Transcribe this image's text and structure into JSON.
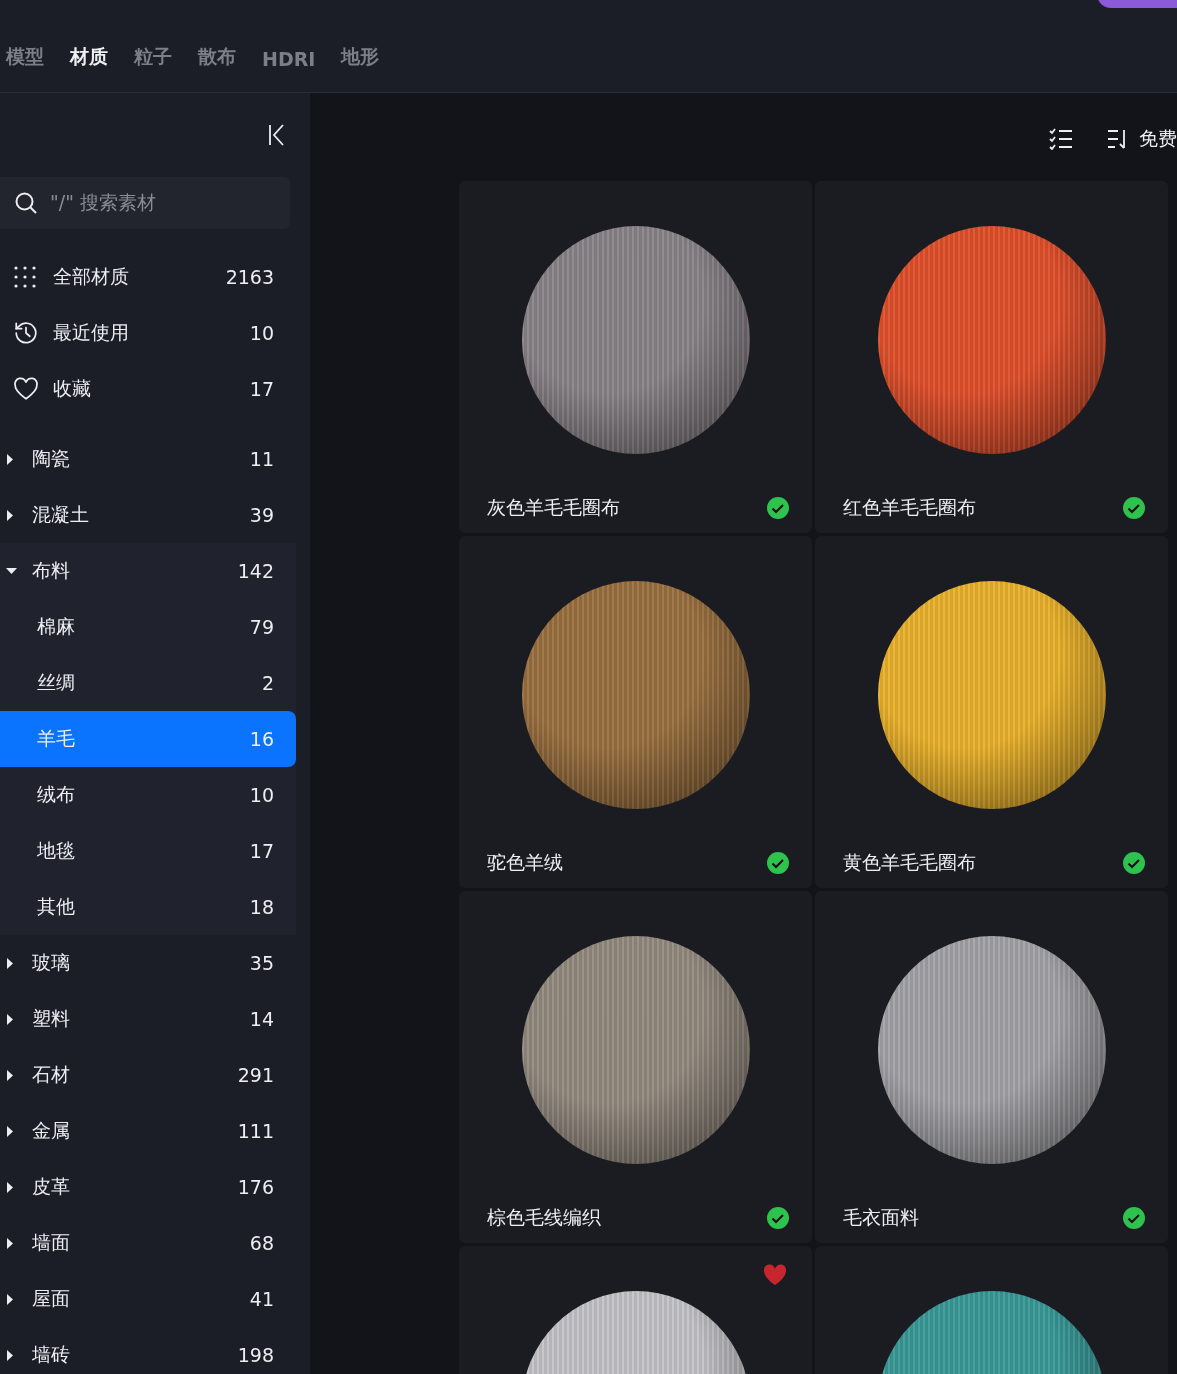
{
  "tabs": [
    {
      "label": "模型",
      "selected": false
    },
    {
      "label": "材质",
      "selected": true
    },
    {
      "label": "粒子",
      "selected": false
    },
    {
      "label": "散布",
      "selected": false
    },
    {
      "label": "HDRI",
      "selected": false
    },
    {
      "label": "地形",
      "selected": false
    }
  ],
  "search": {
    "placeholder": "\"/\" 搜索素材"
  },
  "quick_items": [
    {
      "kind": "grid",
      "label": "全部材质",
      "count": "2163"
    },
    {
      "kind": "history",
      "label": "最近使用",
      "count": "10"
    },
    {
      "kind": "heart",
      "label": "收藏",
      "count": "17"
    }
  ],
  "categories": [
    {
      "label": "陶瓷",
      "count": "11",
      "expanded": false
    },
    {
      "label": "混凝土",
      "count": "39",
      "expanded": false
    },
    {
      "label": "布料",
      "count": "142",
      "expanded": true,
      "children": [
        {
          "label": "棉麻",
          "count": "79",
          "selected": false
        },
        {
          "label": "丝绸",
          "count": "2",
          "selected": false
        },
        {
          "label": "羊毛",
          "count": "16",
          "selected": true
        },
        {
          "label": "绒布",
          "count": "10",
          "selected": false
        },
        {
          "label": "地毯",
          "count": "17",
          "selected": false
        },
        {
          "label": "其他",
          "count": "18",
          "selected": false
        }
      ]
    },
    {
      "label": "玻璃",
      "count": "35",
      "expanded": false
    },
    {
      "label": "塑料",
      "count": "14",
      "expanded": false
    },
    {
      "label": "石材",
      "count": "291",
      "expanded": false
    },
    {
      "label": "金属",
      "count": "111",
      "expanded": false
    },
    {
      "label": "皮革",
      "count": "176",
      "expanded": false
    },
    {
      "label": "墙面",
      "count": "68",
      "expanded": false
    },
    {
      "label": "屋面",
      "count": "41",
      "expanded": false
    },
    {
      "label": "墙砖",
      "count": "198",
      "expanded": false
    }
  ],
  "toolbar": {
    "sort_label": "免费"
  },
  "materials": [
    {
      "name": "灰色羊毛毛圈布",
      "color": "#8a8488",
      "downloaded": true,
      "favorite": false
    },
    {
      "name": "红色羊毛毛圈布",
      "color": "#e0502c",
      "downloaded": true,
      "favorite": false
    },
    {
      "name": "驼色羊绒",
      "color": "#9a7040",
      "downloaded": true,
      "favorite": false
    },
    {
      "name": "黄色羊毛毛圈布",
      "color": "#eab22c",
      "downloaded": true,
      "favorite": false
    },
    {
      "name": "棕色毛线编织",
      "color": "#948b80",
      "downloaded": true,
      "favorite": false
    },
    {
      "name": "毛衣面料",
      "color": "#a4a4a8",
      "downloaded": true,
      "favorite": false
    },
    {
      "color": "#c4c4c8",
      "downloaded": false,
      "favorite": true
    },
    {
      "color": "#3a9a98",
      "downloaded": false,
      "favorite": false
    }
  ]
}
